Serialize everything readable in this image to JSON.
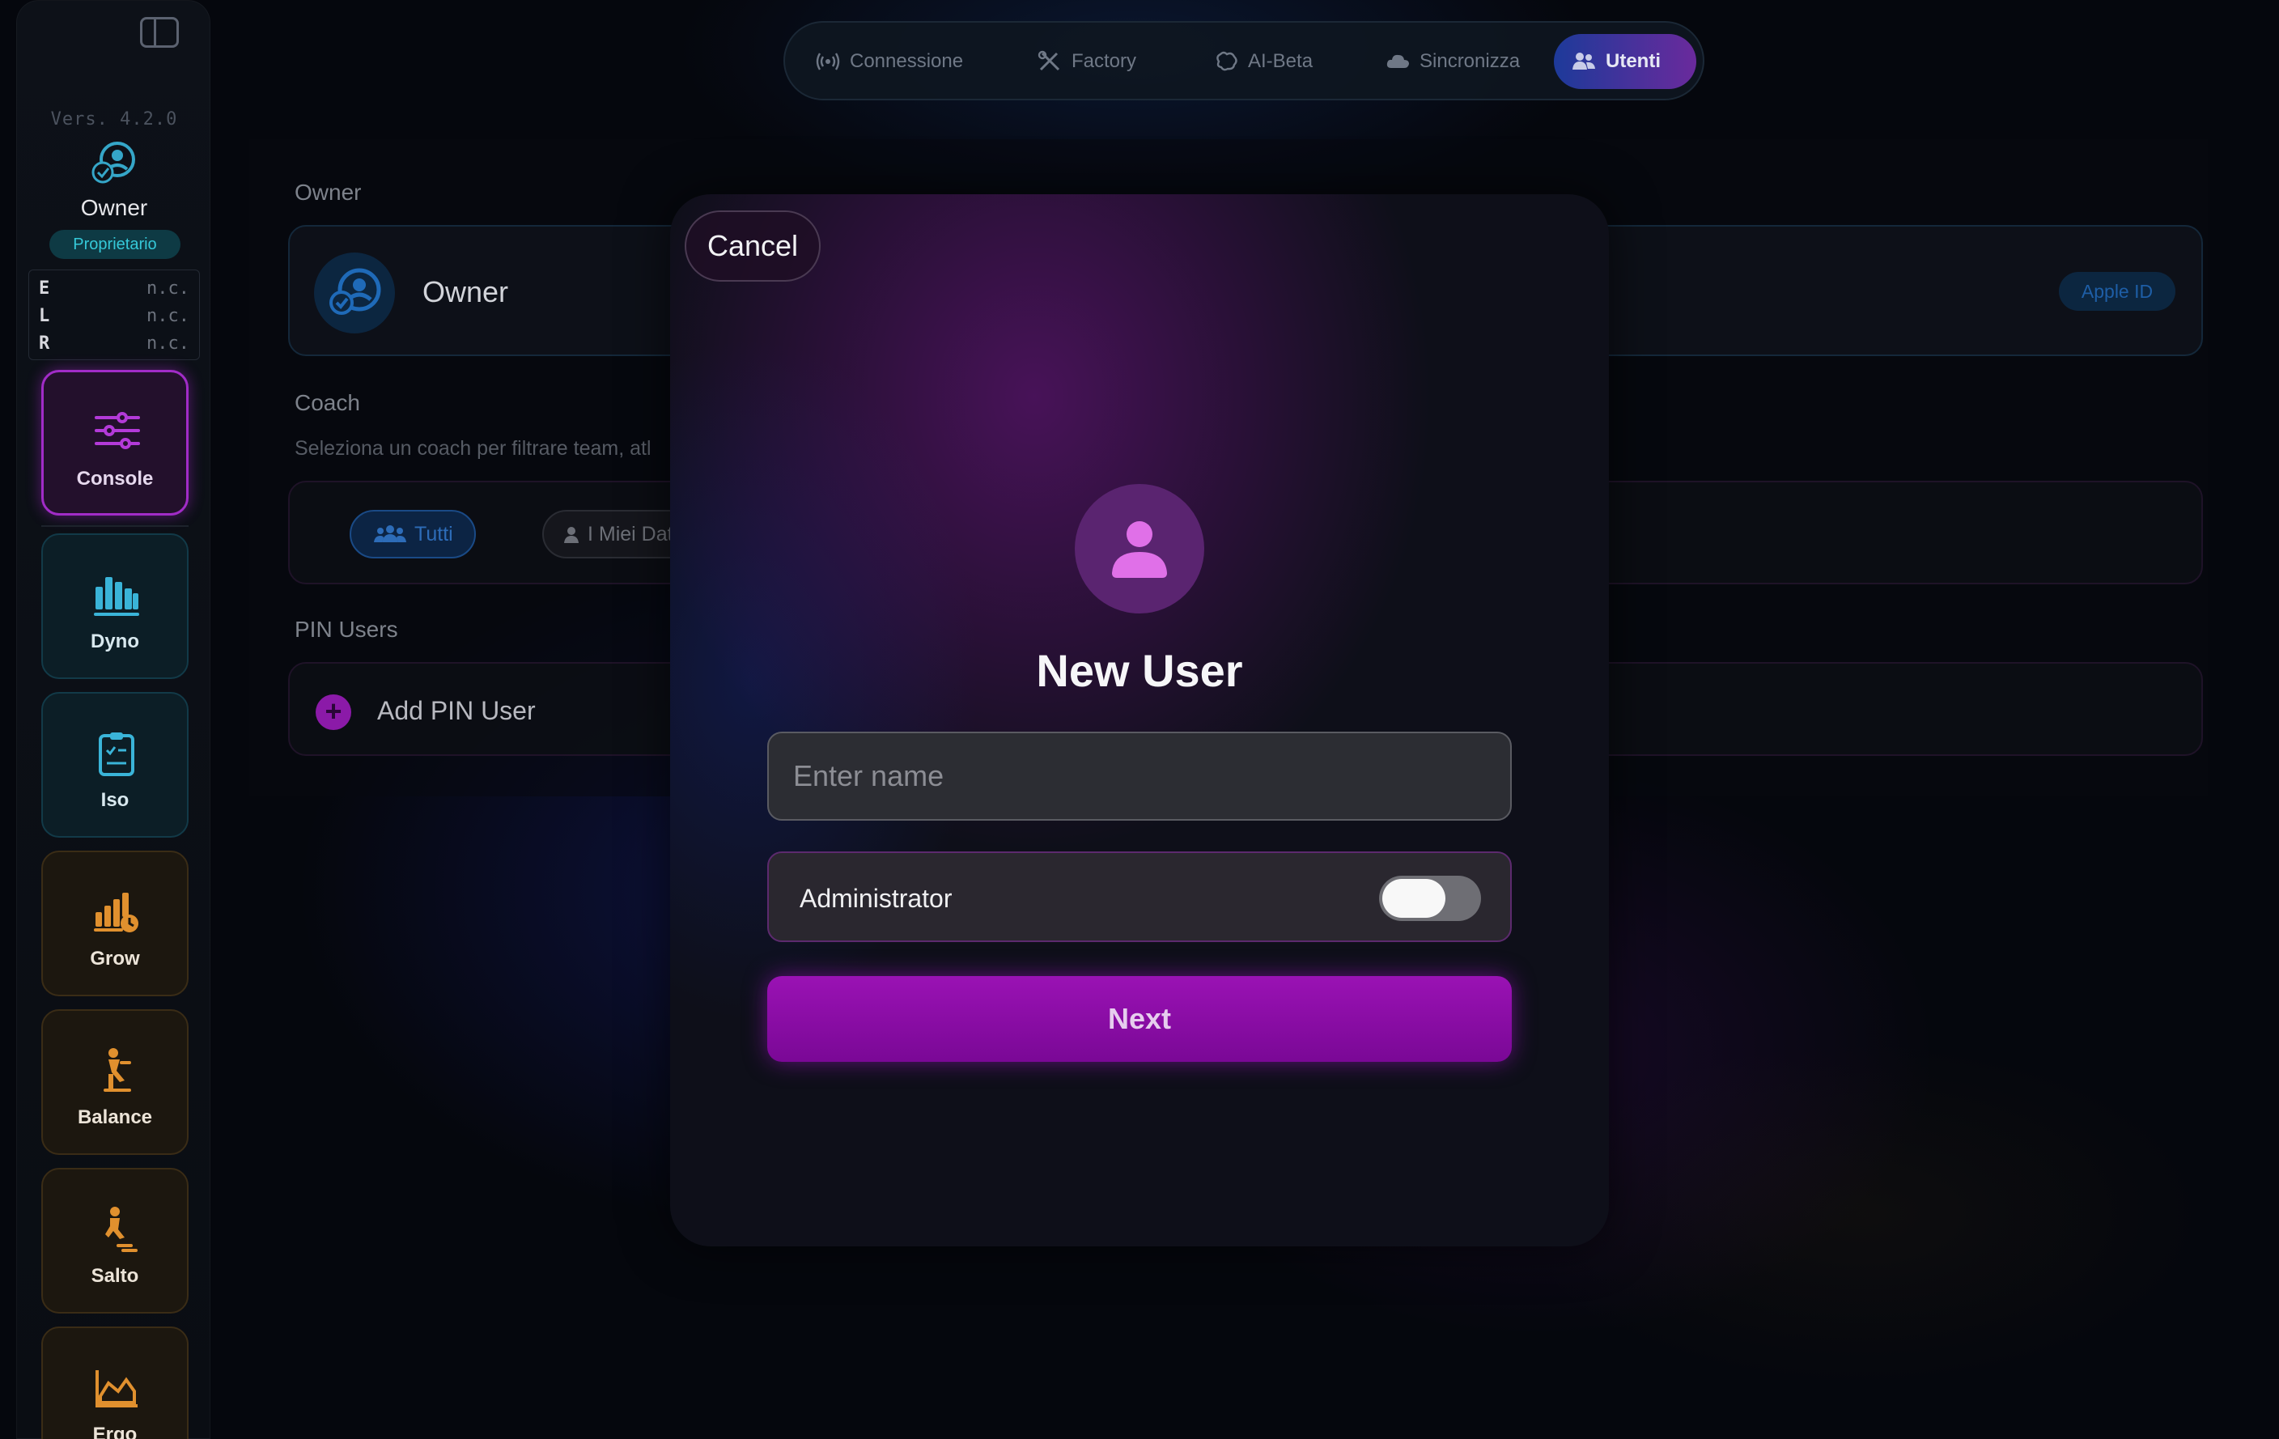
{
  "sidebar": {
    "version": "Vers. 4.2.0",
    "owner_name": "Owner",
    "owner_role": "Proprietario",
    "elr": [
      {
        "key": "E",
        "value": "n.c."
      },
      {
        "key": "L",
        "value": "n.c."
      },
      {
        "key": "R",
        "value": "n.c."
      }
    ],
    "nav": {
      "console": "Console",
      "dyno": "Dyno",
      "iso": "Iso",
      "grow": "Grow",
      "balance": "Balance",
      "salto": "Salto",
      "ergo": "Ergo"
    },
    "active_item": "Console"
  },
  "tabs": {
    "connessione": "Connessione",
    "factory": "Factory",
    "aibeta": "AI-Beta",
    "sincronizza": "Sincronizza",
    "utenti": "Utenti",
    "active": "Utenti"
  },
  "background": {
    "owner_section": "Owner",
    "owner_card_name": "Owner",
    "apple_id_badge": "Apple ID",
    "coach_section": "Coach",
    "coach_description": "Seleziona un coach per filtrare team, atl",
    "pill_tutti": "Tutti",
    "pill_miei": "I Miei Dat",
    "pin_section": "PIN Users",
    "add_pin_user": "Add PIN User"
  },
  "modal": {
    "cancel": "Cancel",
    "title": "New User",
    "name_placeholder": "Enter name",
    "name_value": "",
    "admin_label": "Administrator",
    "admin_enabled": false,
    "next": "Next"
  },
  "colors": {
    "accent_purple": "#9a12b4",
    "console_border": "#a12cc7",
    "teal": "#35c8d8",
    "dyno_iso_icon": "#3ab4d8",
    "grow_icon": "#e0902e"
  }
}
